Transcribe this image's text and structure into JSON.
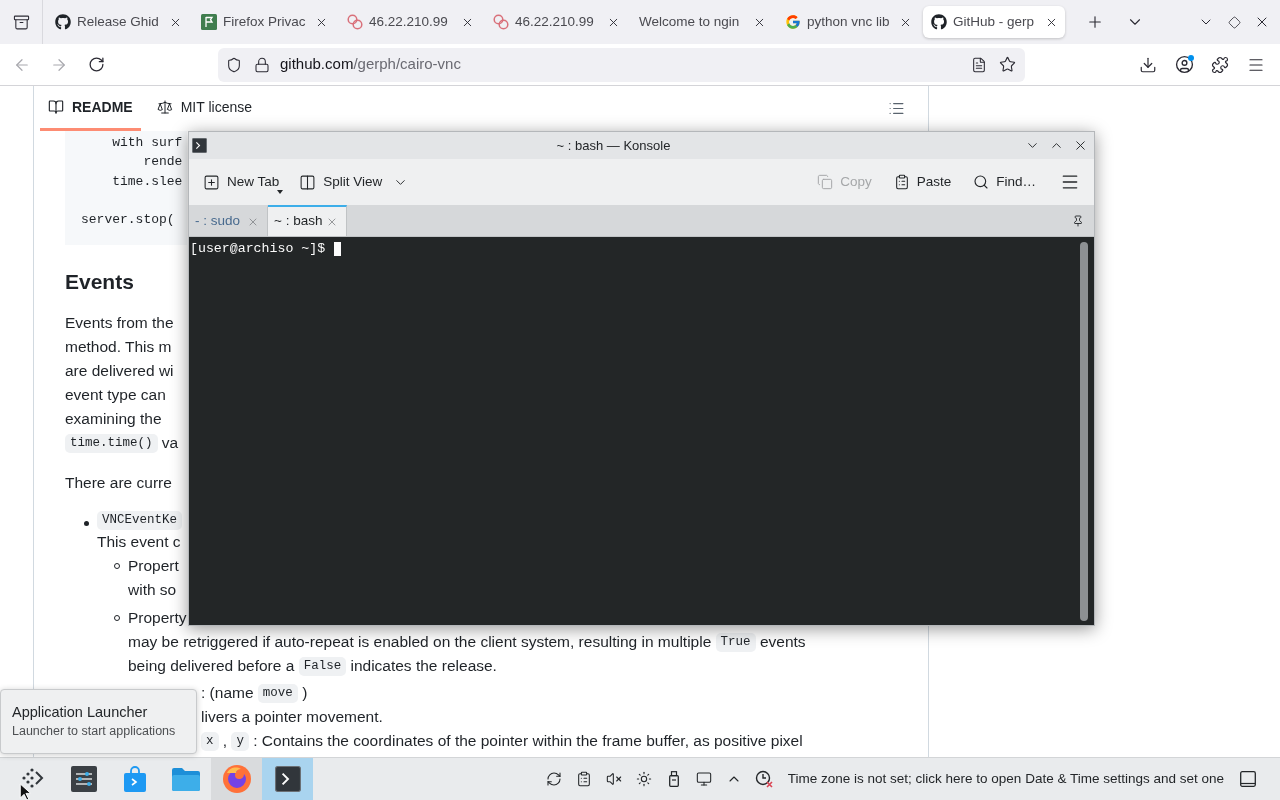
{
  "browser": {
    "tabs": [
      {
        "title": "Release Ghid",
        "kind": "github",
        "selected": false
      },
      {
        "title": "Firefox Privac",
        "kind": "flag",
        "selected": false
      },
      {
        "title": "46.22.210.99",
        "kind": "rings",
        "selected": false
      },
      {
        "title": "46.22.210.99",
        "kind": "rings",
        "selected": false
      },
      {
        "title": "Welcome to ngin",
        "kind": "plain",
        "selected": false
      },
      {
        "title": "python vnc lib",
        "kind": "google",
        "selected": false
      },
      {
        "title": "GitHub - gerp",
        "kind": "github",
        "selected": true
      }
    ],
    "nav": [
      {
        "kind": "back",
        "disabled": true
      },
      {
        "kind": "forward",
        "disabled": true
      },
      {
        "kind": "reload",
        "disabled": false
      }
    ],
    "url": {
      "host": "github.com",
      "path": "/gerph/cairo-vnc"
    },
    "account_notification": true
  },
  "readme": {
    "tabs": [
      {
        "label": "README",
        "kind": "readme",
        "selected": true
      },
      {
        "label": "MIT license",
        "kind": "license",
        "selected": false
      }
    ],
    "code_groups": [
      [
        "    with surf",
        "        rende",
        "    time.slee"
      ],
      [
        "server.stop("
      ]
    ],
    "heading": "Events",
    "paragraphs": [
      [
        [
          {
            "text": "Events from the",
            "code": false
          }
        ],
        [
          {
            "text": "method. This m",
            "code": false
          }
        ],
        [
          {
            "text": "are delivered wi",
            "code": false
          }
        ],
        [
          {
            "text": "event type can",
            "code": false
          }
        ],
        [
          {
            "text": "examining the",
            "code": false
          }
        ],
        [
          {
            "text": "time.time()",
            "code": true
          },
          {
            "text": " va",
            "code": false
          }
        ]
      ],
      [
        [
          {
            "text": "There are curre",
            "code": false
          }
        ]
      ]
    ],
    "events": [
      {
        "lines": [
          [
            {
              "text": "VNCEventKe",
              "code": true
            }
          ],
          [
            {
              "text": "This event c",
              "code": false
            }
          ]
        ],
        "properties": [
          {
            "lines": [
              [
                {
                  "text": "Propert",
                  "code": false
                }
              ],
              [
                {
                  "text": "with so",
                  "code": false
                }
              ]
            ]
          },
          {
            "lines": [
              [
                {
                  "text": "Property",
                  "code": false
                }
              ],
              [
                {
                  "text": "may be retriggered if auto-repeat is enabled on the client system, resulting in multiple ",
                  "code": false
                },
                {
                  "text": "True",
                  "code": true
                },
                {
                  "text": " events",
                  "code": false
                }
              ],
              [
                {
                  "text": "being delivered before a ",
                  "code": false
                },
                {
                  "text": "False",
                  "code": true
                },
                {
                  "text": " indicates the release.",
                  "code": false
                }
              ]
            ]
          }
        ]
      }
    ],
    "uncovered_lines": [
      [
        {
          "text": ": (name ",
          "code": false
        },
        {
          "text": "move",
          "code": true
        },
        {
          "text": " )",
          "code": false
        }
      ],
      [
        {
          "text": "livers a pointer movement.",
          "code": false
        }
      ],
      [
        {
          "text": "x",
          "code": true
        },
        {
          "text": " , ",
          "code": false
        },
        {
          "text": "y",
          "code": true
        },
        {
          "text": " : Contains the coordinates of the pointer within the frame buffer, as positive pixel",
          "code": false
        }
      ]
    ]
  },
  "konsole": {
    "title": "~ : bash — Konsole",
    "toolbar_left": [
      {
        "label": "New Tab",
        "kind": "new-tab",
        "disabled": false
      },
      {
        "label": "Split View",
        "kind": "split-view",
        "disabled": false
      }
    ],
    "toolbar_right": [
      {
        "label": "Copy",
        "kind": "copy",
        "disabled": true
      },
      {
        "label": "Paste",
        "kind": "paste",
        "disabled": false
      },
      {
        "label": "Find…",
        "kind": "find",
        "disabled": false
      }
    ],
    "tabs": [
      {
        "label": "- : sudo",
        "selected": false
      },
      {
        "label": "~ : bash",
        "selected": true
      }
    ],
    "prompt": "[user@archiso ~]$"
  },
  "tooltip": {
    "title": "Application Launcher",
    "subtitle": "Launcher to start applications"
  },
  "taskbar": {
    "apps": [
      {
        "kind": "launcher",
        "running": false,
        "active": false
      },
      {
        "kind": "settings",
        "running": false,
        "active": false
      },
      {
        "kind": "store",
        "running": false,
        "active": false
      },
      {
        "kind": "files",
        "running": false,
        "active": false
      },
      {
        "kind": "firefox",
        "running": true,
        "active": false
      },
      {
        "kind": "terminal",
        "running": true,
        "active": true
      }
    ],
    "clock_message": "Time zone is not set; click here to open Date & Time settings and set one"
  }
}
